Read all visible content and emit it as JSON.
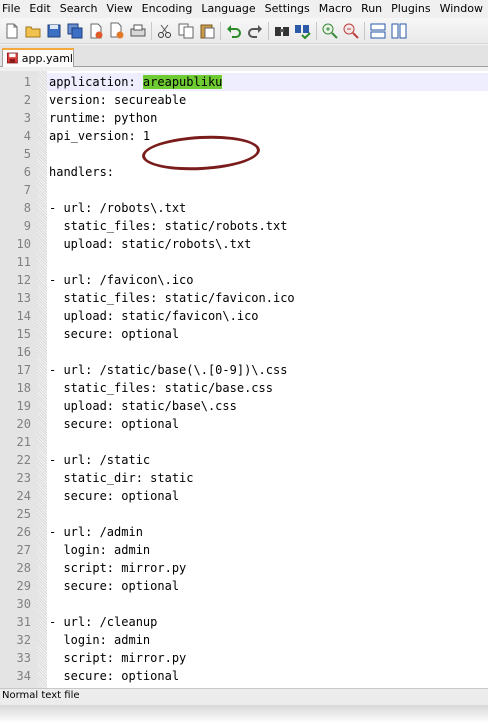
{
  "menu": [
    "File",
    "Edit",
    "Search",
    "View",
    "Encoding",
    "Language",
    "Settings",
    "Macro",
    "Run",
    "Plugins",
    "Window",
    "?"
  ],
  "toolbar": [
    "new-file-icon",
    "open-file-icon",
    "save-icon",
    "save-all-icon",
    "close-icon",
    "close-all-icon",
    "print-icon",
    "cut-icon",
    "copy-icon",
    "paste-icon",
    "undo-icon",
    "redo-icon",
    "find-icon",
    "replace-icon",
    "zoom-in-icon",
    "zoom-out-icon",
    "sync-vertical-icon",
    "sync-horizontal-icon"
  ],
  "tab": {
    "label": "app.yaml"
  },
  "editor": {
    "lines": [
      {
        "n": "1",
        "pre": "application: ",
        "sel": "areapubliku",
        "post": ""
      },
      {
        "n": "2",
        "pre": "version: secureable",
        "sel": "",
        "post": ""
      },
      {
        "n": "3",
        "pre": "runtime: python",
        "sel": "",
        "post": ""
      },
      {
        "n": "4",
        "pre": "api_version: 1",
        "sel": "",
        "post": ""
      },
      {
        "n": "5",
        "pre": "",
        "sel": "",
        "post": ""
      },
      {
        "n": "6",
        "pre": "handlers:",
        "sel": "",
        "post": ""
      },
      {
        "n": "7",
        "pre": "",
        "sel": "",
        "post": ""
      },
      {
        "n": "8",
        "pre": "- url: /robots\\.txt",
        "sel": "",
        "post": ""
      },
      {
        "n": "9",
        "pre": "  static_files: static/robots.txt",
        "sel": "",
        "post": ""
      },
      {
        "n": "10",
        "pre": "  upload: static/robots\\.txt",
        "sel": "",
        "post": ""
      },
      {
        "n": "11",
        "pre": "",
        "sel": "",
        "post": ""
      },
      {
        "n": "12",
        "pre": "- url: /favicon\\.ico",
        "sel": "",
        "post": ""
      },
      {
        "n": "13",
        "pre": "  static_files: static/favicon.ico",
        "sel": "",
        "post": ""
      },
      {
        "n": "14",
        "pre": "  upload: static/favicon\\.ico",
        "sel": "",
        "post": ""
      },
      {
        "n": "15",
        "pre": "  secure: optional",
        "sel": "",
        "post": ""
      },
      {
        "n": "16",
        "pre": "",
        "sel": "",
        "post": ""
      },
      {
        "n": "17",
        "pre": "- url: /static/base(\\.[0-9])\\.css",
        "sel": "",
        "post": ""
      },
      {
        "n": "18",
        "pre": "  static_files: static/base.css",
        "sel": "",
        "post": ""
      },
      {
        "n": "19",
        "pre": "  upload: static/base\\.css",
        "sel": "",
        "post": ""
      },
      {
        "n": "20",
        "pre": "  secure: optional",
        "sel": "",
        "post": ""
      },
      {
        "n": "21",
        "pre": "",
        "sel": "",
        "post": ""
      },
      {
        "n": "22",
        "pre": "- url: /static",
        "sel": "",
        "post": ""
      },
      {
        "n": "23",
        "pre": "  static_dir: static",
        "sel": "",
        "post": ""
      },
      {
        "n": "24",
        "pre": "  secure: optional",
        "sel": "",
        "post": ""
      },
      {
        "n": "25",
        "pre": "",
        "sel": "",
        "post": ""
      },
      {
        "n": "26",
        "pre": "- url: /admin",
        "sel": "",
        "post": ""
      },
      {
        "n": "27",
        "pre": "  login: admin",
        "sel": "",
        "post": ""
      },
      {
        "n": "28",
        "pre": "  script: mirror.py",
        "sel": "",
        "post": ""
      },
      {
        "n": "29",
        "pre": "  secure: optional",
        "sel": "",
        "post": ""
      },
      {
        "n": "30",
        "pre": "",
        "sel": "",
        "post": ""
      },
      {
        "n": "31",
        "pre": "- url: /cleanup",
        "sel": "",
        "post": ""
      },
      {
        "n": "32",
        "pre": "  login: admin",
        "sel": "",
        "post": ""
      },
      {
        "n": "33",
        "pre": "  script: mirror.py",
        "sel": "",
        "post": ""
      },
      {
        "n": "34",
        "pre": "  secure: optional",
        "sel": "",
        "post": ""
      }
    ]
  },
  "status": {
    "text": "Normal text file"
  },
  "colors": {
    "selection": "#6ecc32",
    "annotation_circle": "#7a1c1c",
    "tab_accent": "#f4a73c",
    "gutter": "#e4e4e4"
  }
}
